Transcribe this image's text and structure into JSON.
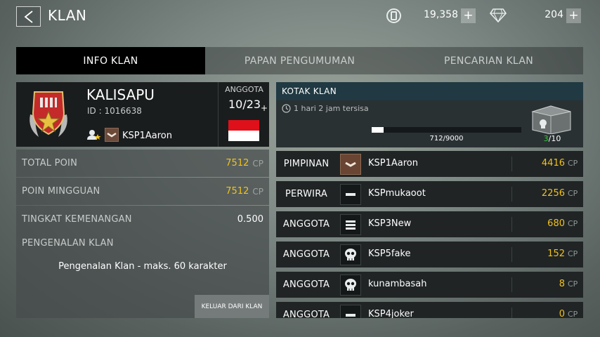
{
  "header": {
    "back_icon": "chevron-left-icon",
    "title": "KLAN",
    "currency": {
      "icon": "coin-icon",
      "value": "19,358",
      "plus": "+"
    },
    "gems": {
      "icon": "diamond-icon",
      "value": "204",
      "plus": "+"
    }
  },
  "tabs": [
    {
      "label": "INFO KLAN",
      "active": true
    },
    {
      "label": "PAPAN PENGUMUMAN",
      "active": false
    },
    {
      "label": "PENCARIAN KLAN",
      "active": false
    }
  ],
  "clan": {
    "emblem": "clan-emblem-icon",
    "name": "KALISAPU",
    "id": "ID : 1016638",
    "leader_icon": "leader-icon",
    "leader_name": "KSP1Aaron",
    "member_label": "ANGGOTA",
    "member_count": "10/23",
    "member_plus": "+",
    "flag": "indonesia-flag",
    "flag_colors": [
      "#e0101a",
      "#ffffff"
    ]
  },
  "stats": [
    {
      "label": "TOTAL POIN",
      "value": "7512",
      "unit": "CP"
    },
    {
      "label": "POIN MINGGUAN",
      "value": "7512",
      "unit": "CP"
    },
    {
      "label": "TINGKAT KEMENANGAN",
      "value": "0.500",
      "unit": ""
    }
  ],
  "intro": {
    "label": "PENGENALAN KLAN",
    "text": "Pengenalan Klan - maks. 60 karakter",
    "leave_button": "KELUAR DARI KLAN"
  },
  "clan_box": {
    "title": "KOTAK KLAN",
    "timer_icon": "clock-icon",
    "timer": "1 hari 2 jam tersisa",
    "progress": "712/9000",
    "progress_fraction": 0.079,
    "crate_icon": "crate-icon",
    "crate_current": "3",
    "crate_total": "/10"
  },
  "members": [
    {
      "role": "PIMPINAN",
      "avatar": "rank-chevron-icon",
      "name": "KSP1Aaron",
      "points": "4416",
      "unit": "CP"
    },
    {
      "role": "PERWIRA",
      "avatar": "rank-bar-icon",
      "name": "KSPmukaoot",
      "points": "2256",
      "unit": "CP"
    },
    {
      "role": "ANGGOTA",
      "avatar": "rank-bars-icon",
      "name": "KSP3New",
      "points": "680",
      "unit": "CP"
    },
    {
      "role": "ANGGOTA",
      "avatar": "skull-icon",
      "name": "KSP5fake",
      "points": "152",
      "unit": "CP"
    },
    {
      "role": "ANGGOTA",
      "avatar": "skull-icon",
      "name": "kunambasah",
      "points": "8",
      "unit": "CP"
    },
    {
      "role": "ANGGOTA",
      "avatar": "rank-bar-icon",
      "name": "KSP4joker",
      "points": "0",
      "unit": "CP"
    }
  ],
  "colors": {
    "accent_gold": "#f2c21a",
    "crate_green": "#38c93a",
    "clan_box_header": "#203942"
  }
}
